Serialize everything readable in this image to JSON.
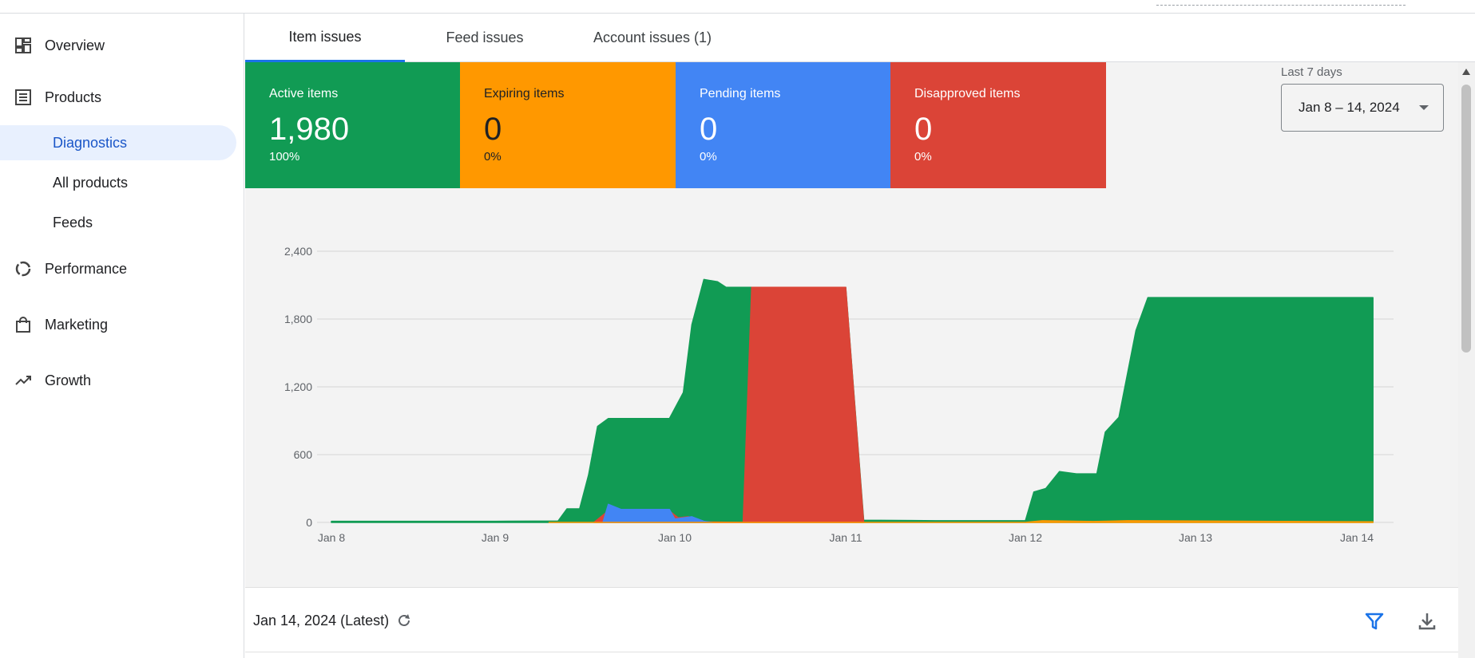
{
  "sidebar": {
    "items": [
      {
        "label": "Overview",
        "icon": "dashboard-icon"
      },
      {
        "label": "Products",
        "icon": "list-icon"
      },
      {
        "label": "Performance",
        "icon": "donut-icon"
      },
      {
        "label": "Marketing",
        "icon": "shopping-bag-icon"
      },
      {
        "label": "Growth",
        "icon": "trending-up-icon"
      }
    ],
    "sub_items": [
      "Diagnostics",
      "All products",
      "Feeds"
    ],
    "active_sub_item": "Diagnostics"
  },
  "tabs": [
    {
      "label": "Item issues",
      "active": true
    },
    {
      "label": "Feed issues",
      "active": false
    },
    {
      "label": "Account issues (1)",
      "active": false
    }
  ],
  "cards": [
    {
      "label": "Active items",
      "value": "1,980",
      "pct": "100%",
      "color": "#119b54"
    },
    {
      "label": "Expiring items",
      "value": "0",
      "pct": "0%",
      "color": "#ff9800"
    },
    {
      "label": "Pending items",
      "value": "0",
      "pct": "0%",
      "color": "#4285f4"
    },
    {
      "label": "Disapproved items",
      "value": "0",
      "pct": "0%",
      "color": "#db4437"
    }
  ],
  "date_range": {
    "caption": "Last 7 days",
    "value": "Jan 8 – 14, 2024"
  },
  "chart_data": {
    "type": "area",
    "x_labels": [
      "Jan 8",
      "Jan 9",
      "Jan 10",
      "Jan 11",
      "Jan 12",
      "Jan 13",
      "Jan 14"
    ],
    "y_ticks": [
      "0",
      "600",
      "1,200",
      "1,800",
      "2,400"
    ],
    "ylim": [
      0,
      2400
    ],
    "grid": true,
    "series": [
      {
        "color": "#119b54",
        "points": [
          [
            0,
            10
          ],
          [
            1,
            10
          ],
          [
            1.35,
            12
          ],
          [
            1.4,
            120
          ],
          [
            1.47,
            120
          ],
          [
            1.52,
            420
          ],
          [
            1.57,
            850
          ],
          [
            1.63,
            920
          ],
          [
            1.97,
            920
          ],
          [
            2.05,
            1150
          ],
          [
            2.1,
            1750
          ],
          [
            2.17,
            2150
          ],
          [
            2.25,
            2130
          ],
          [
            2.3,
            2080
          ],
          [
            3.0,
            2080
          ],
          [
            3.1,
            20
          ],
          [
            3.5,
            15
          ],
          [
            4.0,
            15
          ],
          [
            4.05,
            270
          ],
          [
            4.12,
            300
          ],
          [
            4.2,
            450
          ],
          [
            4.3,
            430
          ],
          [
            4.42,
            430
          ],
          [
            4.47,
            800
          ],
          [
            4.55,
            930
          ],
          [
            4.65,
            1700
          ],
          [
            4.72,
            1990
          ],
          [
            5.0,
            1990
          ],
          [
            6.1,
            1990
          ]
        ]
      },
      {
        "color": "#db4437",
        "points": [
          [
            1.55,
            0
          ],
          [
            1.62,
            90
          ],
          [
            1.98,
            90
          ],
          [
            2.02,
            40
          ],
          [
            2.08,
            50
          ],
          [
            2.15,
            5
          ],
          [
            2.4,
            0
          ],
          [
            2.45,
            2080
          ],
          [
            3.0,
            2080
          ],
          [
            3.1,
            0
          ]
        ]
      },
      {
        "color": "#4285f4",
        "points": [
          [
            1.6,
            0
          ],
          [
            1.63,
            160
          ],
          [
            1.7,
            115
          ],
          [
            1.97,
            115
          ],
          [
            2.0,
            30
          ],
          [
            2.1,
            50
          ],
          [
            2.17,
            10
          ],
          [
            2.22,
            0
          ]
        ]
      },
      {
        "color": "#ff9800",
        "points": [
          [
            1.3,
            0
          ],
          [
            4.0,
            0
          ],
          [
            4.1,
            15
          ],
          [
            4.4,
            8
          ],
          [
            4.6,
            15
          ],
          [
            6.1,
            5
          ]
        ]
      }
    ]
  },
  "footer": {
    "latest_label": "Jan 14, 2024 (Latest)"
  },
  "icons": {
    "refresh": "refresh-icon",
    "filter": "filter-icon",
    "download": "download-icon"
  }
}
